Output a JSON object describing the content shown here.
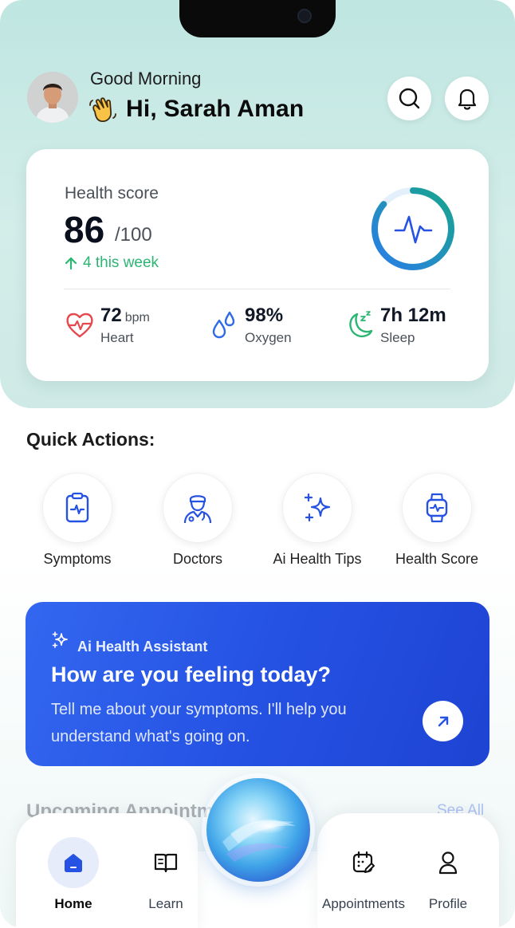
{
  "header": {
    "greeting": "Good Morning",
    "user_name": "Hi, Sarah Aman"
  },
  "health_score": {
    "label": "Health score",
    "value": "86",
    "max": "/100",
    "trend": "4 this week",
    "ring_fraction": 0.86,
    "metrics": [
      {
        "value": "72",
        "unit": "bpm",
        "label": "Heart",
        "icon": "heart-pulse-icon"
      },
      {
        "value": "98%",
        "unit": "",
        "label": "Oxygen",
        "icon": "water-drops-icon"
      },
      {
        "value": "7h 12m",
        "unit": "",
        "label": "Sleep",
        "icon": "moon-zzz-icon"
      }
    ]
  },
  "quick_actions": {
    "title": "Quick Actions:",
    "items": [
      {
        "label": "Symptoms",
        "icon": "clipboard-pulse-icon"
      },
      {
        "label": "Doctors",
        "icon": "doctor-icon"
      },
      {
        "label": "Ai Health Tips",
        "icon": "sparkles-icon"
      },
      {
        "label": "Health Score",
        "icon": "smartwatch-icon"
      }
    ]
  },
  "ai_card": {
    "kicker": "Ai Health Assistant",
    "title": "How are you feeling today?",
    "body": "Tell me about your symptoms. I'll help you understand what's going on."
  },
  "upcoming": {
    "title": "Upcoming Appointments",
    "see_all": "See All"
  },
  "nav": {
    "items": [
      {
        "label": "Home",
        "active": true
      },
      {
        "label": "Learn",
        "active": false
      },
      {
        "label": "Appointments",
        "active": false
      },
      {
        "label": "Profile",
        "active": false
      }
    ]
  },
  "colors": {
    "accent_blue": "#2552e3",
    "teal": "#1a9e8f",
    "green": "#2bb673",
    "heart_red": "#e5484d"
  }
}
